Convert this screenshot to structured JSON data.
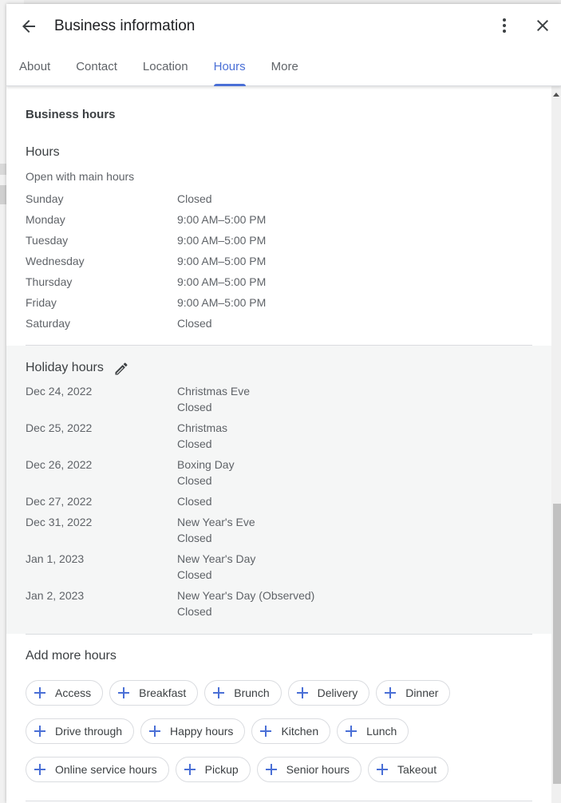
{
  "header": {
    "title": "Business information",
    "back_icon": "arrow-left-icon",
    "more_icon": "more-vert-icon",
    "close_icon": "close-icon"
  },
  "tabs": [
    {
      "label": "About",
      "active": false
    },
    {
      "label": "Contact",
      "active": false
    },
    {
      "label": "Location",
      "active": false
    },
    {
      "label": "Hours",
      "active": true
    },
    {
      "label": "More",
      "active": false
    }
  ],
  "business_hours": {
    "section_title": "Business hours",
    "hours_heading": "Hours",
    "status": "Open with main hours",
    "days": [
      {
        "day": "Sunday",
        "hours": "Closed"
      },
      {
        "day": "Monday",
        "hours": "9:00 AM–5:00 PM"
      },
      {
        "day": "Tuesday",
        "hours": "9:00 AM–5:00 PM"
      },
      {
        "day": "Wednesday",
        "hours": "9:00 AM–5:00 PM"
      },
      {
        "day": "Thursday",
        "hours": "9:00 AM–5:00 PM"
      },
      {
        "day": "Friday",
        "hours": "9:00 AM–5:00 PM"
      },
      {
        "day": "Saturday",
        "hours": "Closed"
      }
    ]
  },
  "holiday_hours": {
    "heading": "Holiday hours",
    "edit_icon": "pencil-icon",
    "entries": [
      {
        "date": "Dec 24, 2022",
        "name": "Christmas Eve",
        "hours": "Closed"
      },
      {
        "date": "Dec 25, 2022",
        "name": "Christmas",
        "hours": "Closed"
      },
      {
        "date": "Dec 26, 2022",
        "name": "Boxing Day",
        "hours": "Closed"
      },
      {
        "date": "Dec 27, 2022",
        "name": "",
        "hours": "Closed"
      },
      {
        "date": "Dec 31, 2022",
        "name": "New Year's Eve",
        "hours": "Closed"
      },
      {
        "date": "Jan 1, 2023",
        "name": "New Year's Day",
        "hours": "Closed"
      },
      {
        "date": "Jan 2, 2023",
        "name": "New Year's Day (Observed)",
        "hours": "Closed"
      }
    ]
  },
  "add_more_hours": {
    "heading": "Add more hours",
    "chip_rows": [
      [
        "Access",
        "Breakfast",
        "Brunch",
        "Delivery",
        "Dinner"
      ],
      [
        "Drive through",
        "Happy hours",
        "Kitchen",
        "Lunch"
      ],
      [
        "Online service hours",
        "Pickup",
        "Senior hours",
        "Takeout"
      ]
    ]
  },
  "colors": {
    "accent": "#4a6fd6",
    "text_primary": "#3c4043",
    "text_secondary": "#5f6368",
    "holiday_bg": "#f5f6f6",
    "divider": "#dadce0"
  },
  "scroll": {
    "position_fraction": 0.53,
    "visible_fraction": 0.4
  }
}
